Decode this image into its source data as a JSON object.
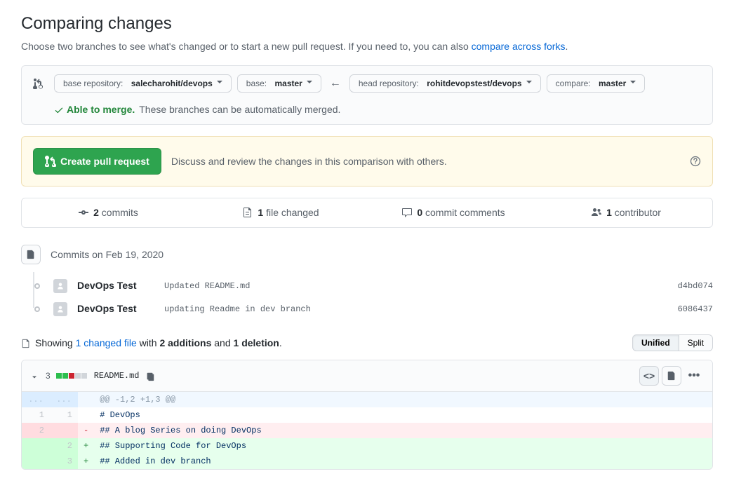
{
  "header": {
    "title": "Comparing changes",
    "subtitle_pre": "Choose two branches to see what's changed or to start a new pull request. If you need to, you can also ",
    "subtitle_link": "compare across forks",
    "subtitle_post": "."
  },
  "compare": {
    "base_repo_label": "base repository:",
    "base_repo_value": "salecharohit/devops",
    "base_label": "base:",
    "base_value": "master",
    "head_repo_label": "head repository:",
    "head_repo_value": "rohitdevopstest/devops",
    "compare_label": "compare:",
    "compare_value": "master",
    "merge_ok": "Able to merge.",
    "merge_msg": "These branches can be automatically merged."
  },
  "pr": {
    "button": "Create pull request",
    "discuss": "Discuss and review the changes in this comparison with others."
  },
  "stats": {
    "commits_n": "2",
    "commits_l": "commits",
    "files_n": "1",
    "files_l": "file changed",
    "comments_n": "0",
    "comments_l": "commit comments",
    "contrib_n": "1",
    "contrib_l": "contributor"
  },
  "timeline": {
    "date_label": "Commits on Feb 19, 2020",
    "commits": [
      {
        "author": "DevOps Test",
        "message": "Updated README.md",
        "sha": "d4bd074"
      },
      {
        "author": "DevOps Test",
        "message": "updating Readme in dev branch",
        "sha": "6086437"
      }
    ]
  },
  "summary": {
    "showing": "Showing",
    "file_link": "1 changed file",
    "with": "with",
    "additions": "2 additions",
    "and": "and",
    "deletions": "1 deletion",
    "tail": ".",
    "unified": "Unified",
    "split": "Split"
  },
  "file": {
    "lines_changed": "3",
    "name": "README.md",
    "hunk": "@@ -1,2 +1,3 @@",
    "rows": [
      {
        "type": "ctx",
        "old": "1",
        "new": "1",
        "sign": " ",
        "text": "# DevOps"
      },
      {
        "type": "del",
        "old": "2",
        "new": "",
        "sign": "-",
        "text": "## A blog Series on doing DevOps"
      },
      {
        "type": "add",
        "old": "",
        "new": "2",
        "sign": "+",
        "text": "## Supporting Code for DevOps"
      },
      {
        "type": "add",
        "old": "",
        "new": "3",
        "sign": "+",
        "text": "## Added in dev branch"
      }
    ]
  }
}
